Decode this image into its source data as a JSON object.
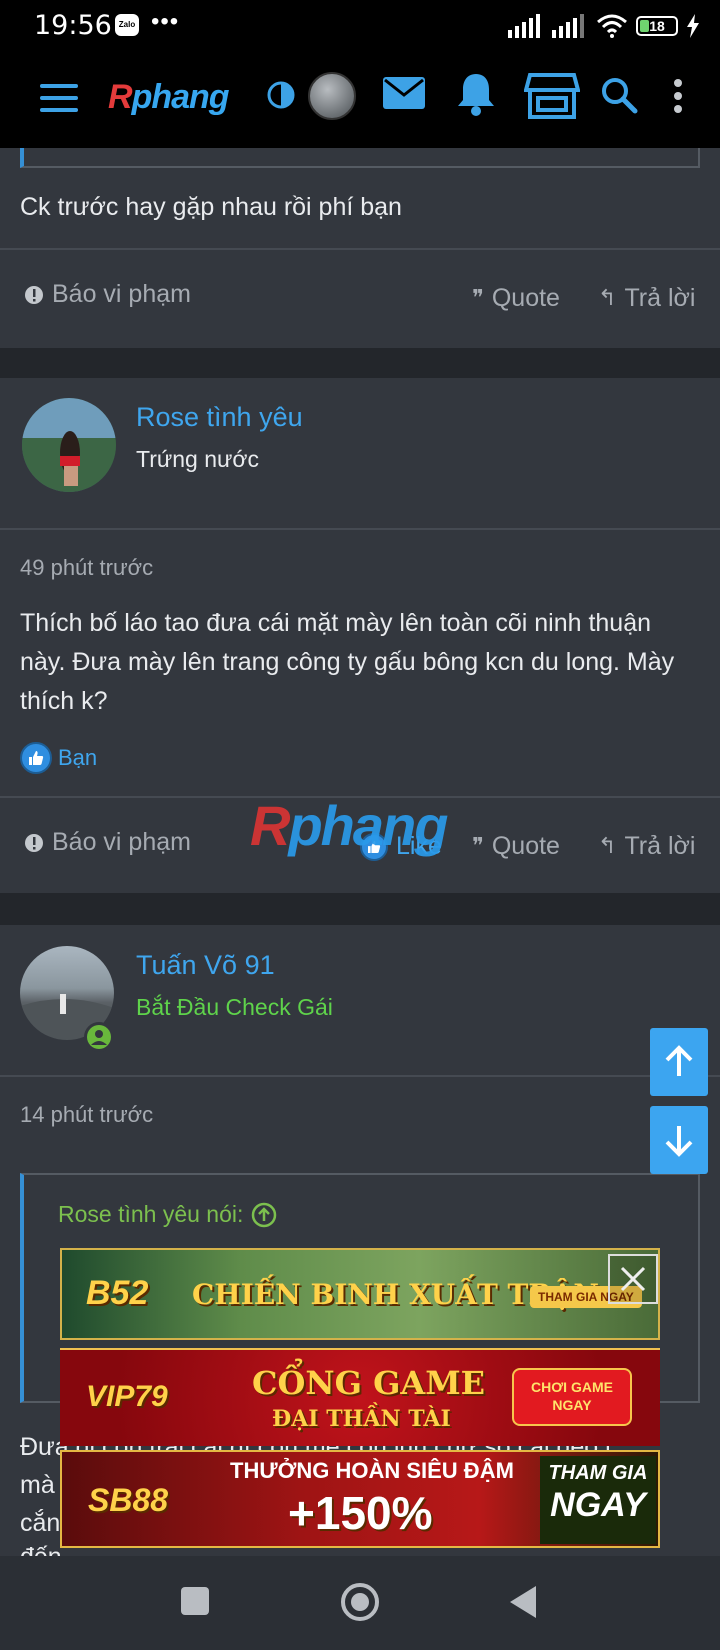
{
  "status_bar": {
    "time": "19:56",
    "zalo_label": "Zalo",
    "overflow_dots": "•••",
    "battery": "18"
  },
  "nav": {
    "logo_r": "R",
    "logo_rest": "phang",
    "accent_color": "#3da2e6"
  },
  "prev_post": {
    "text": "Ck trước hay gặp nhau rồi phí bạn",
    "report_label": "Báo vi phạm",
    "quote_label": "Quote",
    "reply_label": "Trả lời"
  },
  "post1": {
    "author": "Rose tình yêu",
    "user_title": "Trứng nước",
    "time_ago": "49 phút trước",
    "text": "Thích bố láo tao đưa cái mặt mày lên toàn cõi ninh thuận này. Đưa mày lên trang công ty gấu bông kcn du long. Mày thích k?",
    "reaction_label": "Bạn",
    "report_label": "Báo vi phạm",
    "like_label": "Like",
    "quote_label": "Quote",
    "reply_label": "Trả lời"
  },
  "post2": {
    "author": "Tuấn Võ 91",
    "user_title": "Bắt Đầu Check Gái",
    "user_title_color": "#5fd34b",
    "time_ago": "14 phút trước",
    "quote_author": "Rose tình yêu nói:",
    "text_line1": "Đưa đi con trai cái đĩ con mẹ con lũn chữ số cái đéo j",
    "text_line2": "mà",
    "text_line3": "cắn",
    "text_line4": "đến..."
  },
  "watermark": {
    "r": "R",
    "rest": "phang"
  },
  "ads": {
    "b52": {
      "brand": "B52",
      "headline": "CHIẾN BINH XUẤT TRẬN",
      "cta": "THAM GIA NGAY"
    },
    "vip79": {
      "brand": "VIP79",
      "headline_1": "CỔNG GAME",
      "headline_2": "ĐẠI THẦN TÀI",
      "cta_1": "CHƠI GAME",
      "cta_2": "NGAY"
    },
    "sb88": {
      "brand": "SB88",
      "headline_1": "THƯỞNG HOÀN SIÊU ĐẬM",
      "headline_2": "+150%",
      "cta_1": "THAM GIA",
      "cta_2": "NGAY"
    }
  }
}
